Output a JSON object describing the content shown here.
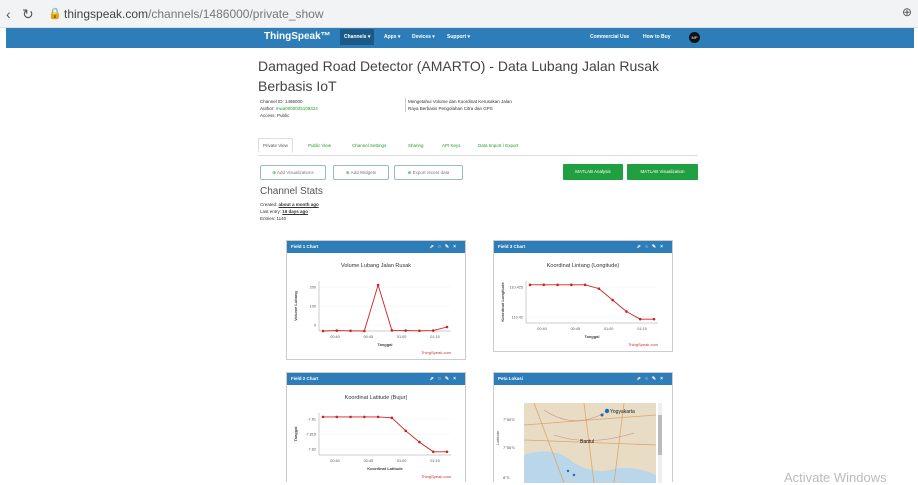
{
  "browser": {
    "url_host": "thingspeak.com",
    "url_path": "/channels/1486000/private_show"
  },
  "navbar": {
    "brand": "ThingSpeak™",
    "items": [
      "Channels ▾",
      "Apps ▾",
      "Devices ▾",
      "Support ▾"
    ],
    "right_items": [
      "Commercial Use",
      "How to Buy"
    ],
    "avatar_initials": "MP"
  },
  "channel": {
    "title": "Damaged Road Detector (AMARTO) - Data Lubang Jalan Rusak Berbasis IoT",
    "id_line": "Channel ID: 1486000",
    "author_label": "Author: ",
    "author_value": "mwa0000025109324",
    "access_line": "Access: Public",
    "description_line1": "Mengetahui Volume dan Koordinat Kerusakan Jalan",
    "description_line2": "Raya Berbasis Pengolahan Citra dan GPS"
  },
  "tabs": [
    "Private View",
    "Public View",
    "Channel Settings",
    "Sharing",
    "API Keys",
    "Data Import / Export"
  ],
  "buttons": {
    "add_visualizations": "Add Visualizations",
    "add_widgets": "Add Widgets",
    "export_recent": "Export recent data",
    "matlab_analysis": "MATLAB Analysis",
    "matlab_visualization": "MATLAB Visualization"
  },
  "stats": {
    "title": "Channel Stats",
    "created_label": "Created: ",
    "created_value": "about a month ago",
    "last_entry_label": "Last entry: ",
    "last_entry_value": "16 days ago",
    "entries_line": "Entries: 1140"
  },
  "panels": {
    "field1": {
      "header": "Field 1 Chart",
      "chart_title": "Volume Lubang Jalan Rusak",
      "ylabel": "Volume Lubang",
      "xlabel": "Tanggal",
      "credit": "ThingSpeak.com",
      "yticks": [
        "200",
        "100",
        "0"
      ],
      "xticks": [
        "00:40",
        "00:45",
        "01:00",
        "01:15"
      ]
    },
    "field3": {
      "header": "Field 3 Chart",
      "chart_title": "Koordinat Lintang (Longitude)",
      "ylabel": "Koordinat Longitude",
      "xlabel": "Tanggal",
      "credit": "ThingSpeak.com",
      "yticks": [
        "110.425",
        "110.42"
      ],
      "xticks": [
        "00:40",
        "00:45",
        "01:00",
        "01:15"
      ]
    },
    "field2": {
      "header": "Field 2 Chart",
      "chart_title": "Koordinat Latitude (Bujur)",
      "ylabel": "Tanggal",
      "xlabel": "Koordinat Latitude",
      "credit": "ThingSpeak.com",
      "yticks": [
        "-7.81",
        "-7.815",
        "-7.82"
      ],
      "xticks": [
        "00:40",
        "00:45",
        "01:00",
        "01:15"
      ]
    },
    "map": {
      "header": "Peta Lokasi",
      "city_label": "Yogyakarta",
      "town_label": "Bantul",
      "yticks": [
        "7°50'S",
        "7°55'S",
        "8°S"
      ],
      "ylabel": "Latitude"
    }
  },
  "watermark": "Activate Windows",
  "colors": {
    "navbar": "#2d7eb8",
    "accent_green": "#20a040",
    "series": "#cc2222"
  },
  "chart_data": [
    {
      "type": "line",
      "title": "Volume Lubang Jalan Rusak",
      "xlabel": "Tanggal",
      "ylabel": "Volume Lubang",
      "x": [
        "00:35",
        "00:40",
        "00:45",
        "00:50",
        "00:55",
        "01:00",
        "01:05",
        "01:10",
        "01:15",
        "01:20"
      ],
      "series": [
        {
          "values": [
            0,
            2,
            1,
            0,
            230,
            3,
            2,
            1,
            2,
            20
          ]
        }
      ],
      "ylim": [
        0,
        250
      ]
    },
    {
      "type": "line",
      "title": "Koordinat Lintang (Longitude)",
      "xlabel": "Tanggal",
      "ylabel": "Koordinat Longitude",
      "x": [
        "00:35",
        "00:40",
        "00:45",
        "00:50",
        "00:55",
        "01:00",
        "01:05",
        "01:10",
        "01:15",
        "01:20"
      ],
      "series": [
        {
          "values": [
            110.428,
            110.428,
            110.428,
            110.428,
            110.428,
            110.427,
            110.424,
            110.421,
            110.419,
            110.419
          ]
        }
      ],
      "ylim": [
        110.418,
        110.429
      ]
    },
    {
      "type": "line",
      "title": "Koordinat Latitude (Bujur)",
      "xlabel": "Koordinat Latitude",
      "ylabel": "Tanggal",
      "x": [
        "00:35",
        "00:40",
        "00:45",
        "00:50",
        "00:55",
        "01:00",
        "01:05",
        "01:10",
        "01:15",
        "01:20"
      ],
      "series": [
        {
          "values": [
            -7.8102,
            -7.8102,
            -7.8102,
            -7.8102,
            -7.8102,
            -7.8105,
            -7.8145,
            -7.818,
            -7.821,
            -7.821
          ]
        }
      ],
      "ylim": [
        -7.822,
        -7.809
      ]
    }
  ]
}
